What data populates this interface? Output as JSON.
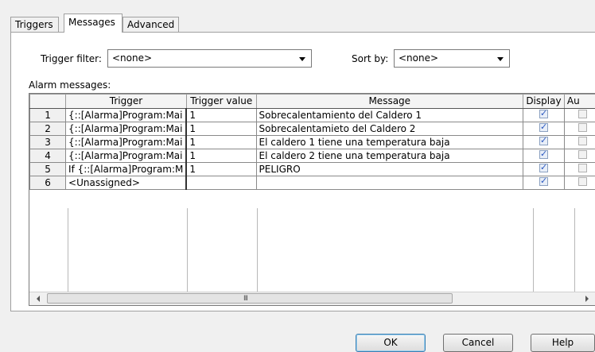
{
  "tabs": [
    {
      "label": "Triggers",
      "active": false
    },
    {
      "label": "Messages",
      "active": true
    },
    {
      "label": "Advanced",
      "active": false
    }
  ],
  "filters": {
    "trigger_filter_label": "Trigger filter:",
    "trigger_filter_value": "<none>",
    "sort_by_label": "Sort by:",
    "sort_by_value": "<none>"
  },
  "alarm_messages_label": "Alarm messages:",
  "grid": {
    "columns": [
      "",
      "Trigger",
      "Trigger value",
      "Message",
      "Display",
      "Au"
    ],
    "rows": [
      {
        "num": "1",
        "trigger": "{::[Alarma]Program:Mai",
        "value": "1",
        "message": "Sobrecalentamiento del Caldero 1",
        "display": true
      },
      {
        "num": "2",
        "trigger": "{::[Alarma]Program:Mai",
        "value": "1",
        "message": "Sobrecalentamieto del Caldero 2",
        "display": true
      },
      {
        "num": "3",
        "trigger": "{::[Alarma]Program:Mai",
        "value": "1",
        "message": "El caldero 1 tiene una temperatura baja",
        "display": true
      },
      {
        "num": "4",
        "trigger": "{::[Alarma]Program:Mai",
        "value": "1",
        "message": "El caldero 2 tiene una temperatura baja",
        "display": true
      },
      {
        "num": "5",
        "trigger": "If {::[Alarma]Program:M",
        "value": "1",
        "message": "PELIGRO",
        "display": true
      },
      {
        "num": "6",
        "trigger": "<Unassigned>",
        "value": "",
        "message": "",
        "display": true
      }
    ],
    "scroll_grip": "III"
  },
  "buttons": {
    "ok": "OK",
    "cancel": "Cancel",
    "help": "Help"
  }
}
